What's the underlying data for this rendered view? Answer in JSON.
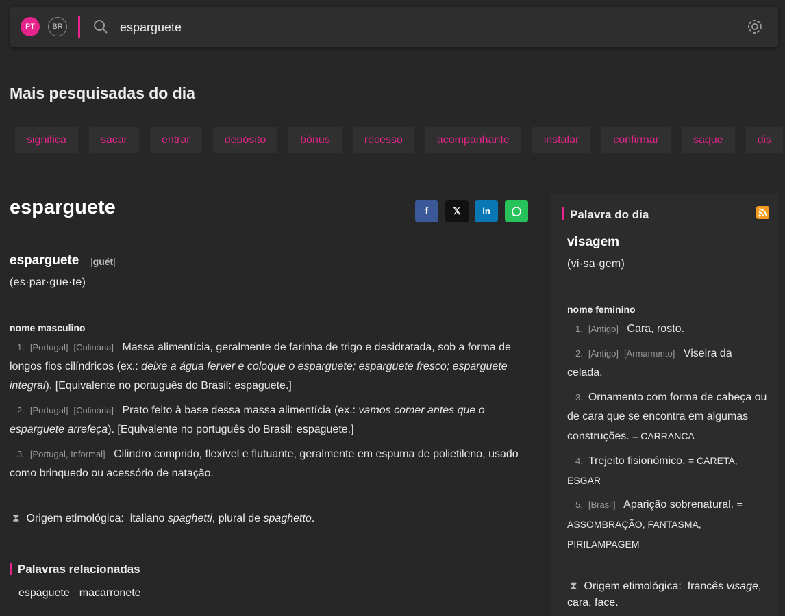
{
  "header": {
    "lang_pt": "PT",
    "lang_br": "BR",
    "search_value": "esparguete"
  },
  "trending": {
    "title": "Mais pesquisadas do dia",
    "items": [
      "significa",
      "sacar",
      "entrar",
      "depósito",
      "bônus",
      "recesso",
      "acompanhante",
      "instalar",
      "confirmar",
      "saque",
      "dis"
    ]
  },
  "entry": {
    "title": "esparguete",
    "headword": "esparguete",
    "pron": "guét",
    "syllables": "(es·par·gue·te)",
    "gram": "nome masculino",
    "defs": [
      {
        "num": "1.",
        "tags": [
          "[Portugal]",
          "[Culinária]"
        ],
        "text": "Massa alimentícia, geralmente de farinha de trigo e desidratada, sob a forma de longos fios cilíndricos (ex.: ",
        "example": "deixe a água ferver e coloque o esparguete; esparguete fresco; esparguete integral",
        "after": "). [Equivalente no português do Brasil: espaguete.]"
      },
      {
        "num": "2.",
        "tags": [
          "[Portugal]",
          "[Culinária]"
        ],
        "text": "Prato feito à base dessa massa alimentícia (ex.: ",
        "example": "vamos comer antes que o esparguete arrefeça",
        "after": "). [Equivalente no português do Brasil: espaguete.]"
      },
      {
        "num": "3.",
        "tags": [
          "[Portugal, Informal]"
        ],
        "text": "Cilindro comprido, flexível e flutuante, geralmente em espuma de polietileno, usado como brinquedo ou acessório de natação.",
        "example": "",
        "after": ""
      }
    ],
    "etym_label": "Origem etimológica:",
    "etym_pre": "italiano",
    "etym_w1": "spaghetti",
    "etym_mid": ", plural de",
    "etym_w2": "spaghetto",
    "etym_end": "."
  },
  "related": {
    "title": "Palavras relacionadas",
    "items": [
      "espaguete",
      "macarronete"
    ]
  },
  "word_of_day": {
    "title": "Palavra do dia",
    "word": "visagem",
    "syllables": "(vi·sa·gem)",
    "gram": "nome feminino",
    "defs": [
      {
        "num": "1.",
        "tags": [
          "[Antigo]"
        ],
        "text": "Cara, rosto.",
        "syn": ""
      },
      {
        "num": "2.",
        "tags": [
          "[Antigo]",
          "[Armamento]"
        ],
        "text": "Viseira da celada.",
        "syn": ""
      },
      {
        "num": "3.",
        "tags": [],
        "text": "Ornamento com forma de cabeça ou de cara que se encontra em algumas construções.",
        "syn": "= CARRANCA"
      },
      {
        "num": "4.",
        "tags": [],
        "text": "Trejeito fisionómico.",
        "syn": "= CARETA, ESGAR"
      },
      {
        "num": "5.",
        "tags": [
          "[Brasil]"
        ],
        "text": "Aparição sobrenatural.",
        "syn": "= ASSOMBRAÇÃO, FANTASMA, PIRILAMPAGEM"
      }
    ],
    "etym_label": "Origem etimológica:",
    "etym_pre": "francês",
    "etym_w": "visage",
    "etym_end": ", cara, face."
  }
}
